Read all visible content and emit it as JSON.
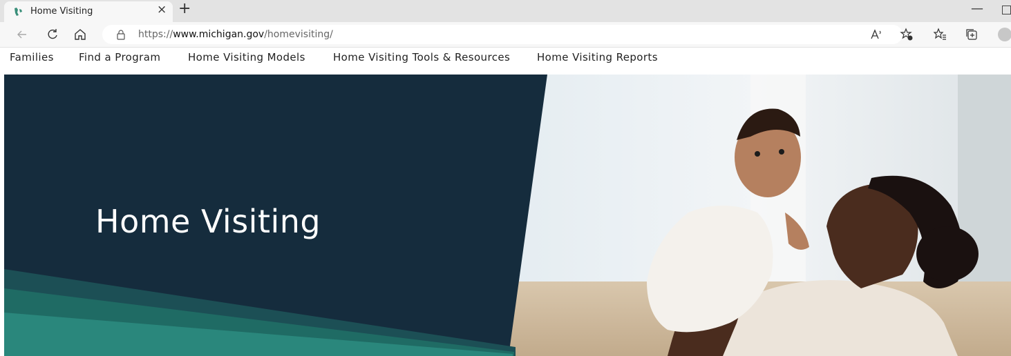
{
  "browser": {
    "tab": {
      "title": "Home Visiting",
      "close_glyph": "×",
      "favicon": "michigan-favicon-icon"
    },
    "new_tab_glyph": "+",
    "minimize_glyph": "—",
    "address": {
      "scheme": "https://",
      "host": "www.michigan.gov",
      "path": "/homevisiting/"
    },
    "icons": [
      "back-icon",
      "refresh-icon",
      "home-icon",
      "lock-icon",
      "read-aloud-icon",
      "add-favorite-icon",
      "favorites-icon",
      "collections-icon",
      "profile-avatar"
    ]
  },
  "nav": {
    "items": [
      {
        "label": "Families"
      },
      {
        "label": "Find a Program"
      },
      {
        "label": "Home Visiting Models"
      },
      {
        "label": "Home Visiting Tools & Resources"
      },
      {
        "label": "Home Visiting Reports"
      }
    ]
  },
  "hero": {
    "title": "Home Visiting",
    "photo": "mother-kissing-baby-photo"
  },
  "colors": {
    "hero_navy": "#152c3d",
    "hero_teal": "#1f6b64",
    "hero_teal_light": "#2a877c",
    "tab_bg": "#e3e3e3",
    "toolbar_bg": "#f7f7f7"
  }
}
